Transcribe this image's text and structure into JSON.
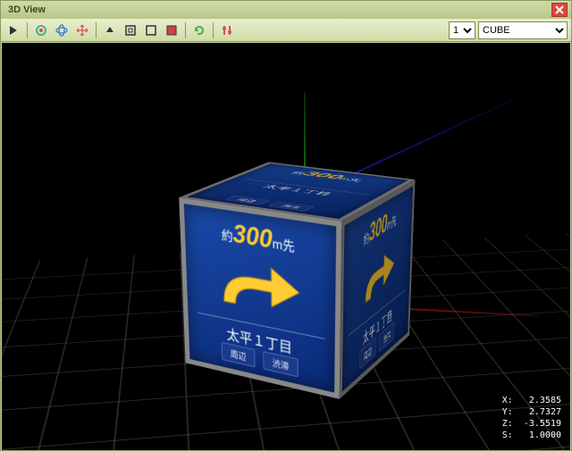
{
  "window": {
    "title": "3D View"
  },
  "toolbar": {
    "number": "1",
    "object": "CUBE"
  },
  "cube_texture": {
    "distance_prefix": "約",
    "distance_value": "300",
    "distance_unit": "m先",
    "destination": "太平１丁目",
    "button_left": "周辺",
    "button_right": "渋滞"
  },
  "coords": {
    "x": "X:   2.3585",
    "y": "Y:   2.7327",
    "z": "Z:  -3.5519",
    "s": "S:   1.0000"
  }
}
